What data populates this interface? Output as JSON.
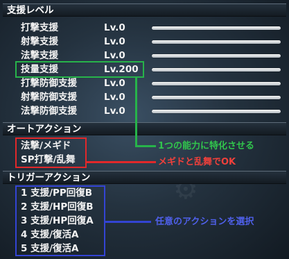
{
  "sections": {
    "support_level": "支援レベル",
    "auto_action": "オートアクション",
    "trigger_action": "トリガーアクション"
  },
  "support_levels": [
    {
      "name": "打撃支援",
      "level": "Lv.0"
    },
    {
      "name": "射撃支援",
      "level": "Lv.0"
    },
    {
      "name": "法撃支援",
      "level": "Lv.0"
    },
    {
      "name": "技量支援",
      "level": "Lv.200"
    },
    {
      "name": "打撃防御支援",
      "level": "Lv.0"
    },
    {
      "name": "射撃防御支援",
      "level": "Lv.0"
    },
    {
      "name": "法撃防御支援",
      "level": "Lv.0"
    }
  ],
  "auto_actions": [
    "法撃/メギド",
    "SP打撃/乱舞"
  ],
  "trigger_actions": [
    "1 支援/PP回復B",
    "2 支援/HP回復B",
    "3 支援/HP回復A",
    "4 支援/復活A",
    "5 支援/復活A"
  ],
  "annotations": {
    "green": "1つの能力に特化させる",
    "red": "メギドと乱舞でOK",
    "blue": "任意のアクションを選択"
  },
  "colors": {
    "green": "#27b34a",
    "red": "#e2282a",
    "blue": "#3344d4"
  }
}
